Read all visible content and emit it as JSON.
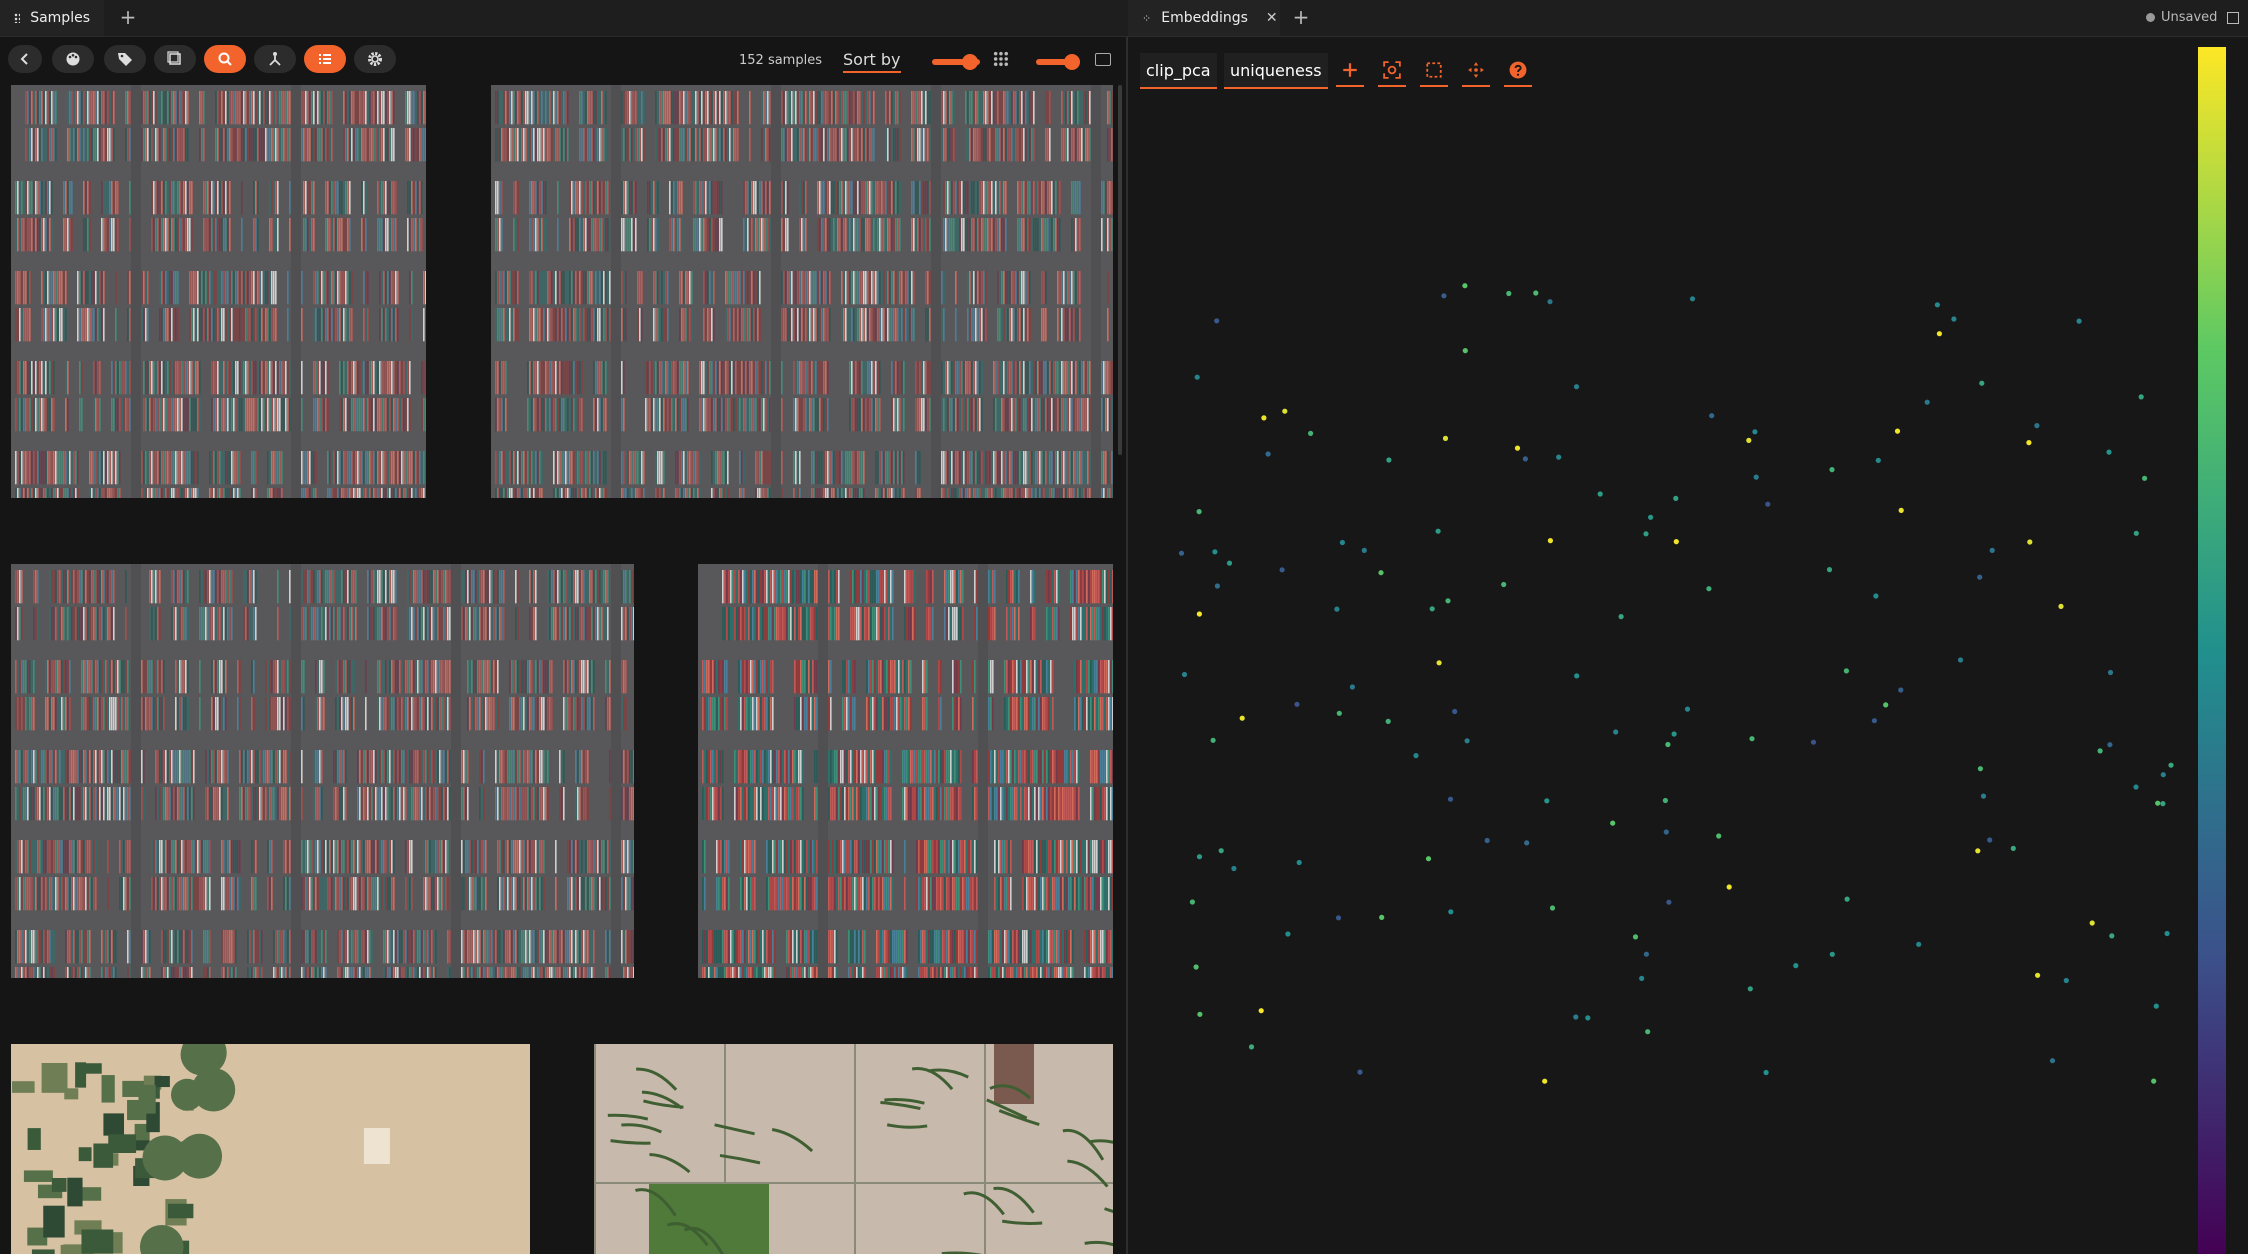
{
  "tabs": {
    "left": {
      "label": "Samples"
    },
    "right": {
      "label": "Embeddings"
    },
    "status": "Unsaved"
  },
  "toolbar": {
    "buttons": [
      "back-icon",
      "palette-icon",
      "tag-icon",
      "patches-icon",
      "search-icon",
      "similarity-icon",
      "list-icon",
      "gear-icon"
    ],
    "active": [
      "search-icon",
      "list-icon"
    ],
    "count_text": "152 samples",
    "sort_label": "Sort by",
    "grid_icon": "grid-icon",
    "layout_icon": "layout-icon"
  },
  "samples": [
    {
      "type": "port"
    },
    {
      "type": "port"
    },
    {
      "type": "port"
    },
    {
      "type": "port"
    },
    {
      "type": "farm-desert"
    },
    {
      "type": "farm-field"
    }
  ],
  "embeddings": {
    "brain_key": "clip_pca",
    "color_by": "uniqueness",
    "icons": [
      "plus-icon",
      "fit-view-icon",
      "lasso-select-icon",
      "pan-icon",
      "help-icon"
    ],
    "colorscale": {
      "name": "viridis",
      "colors": [
        "#440154",
        "#3b528b",
        "#21908d",
        "#5dc963",
        "#fde725"
      ]
    }
  }
}
